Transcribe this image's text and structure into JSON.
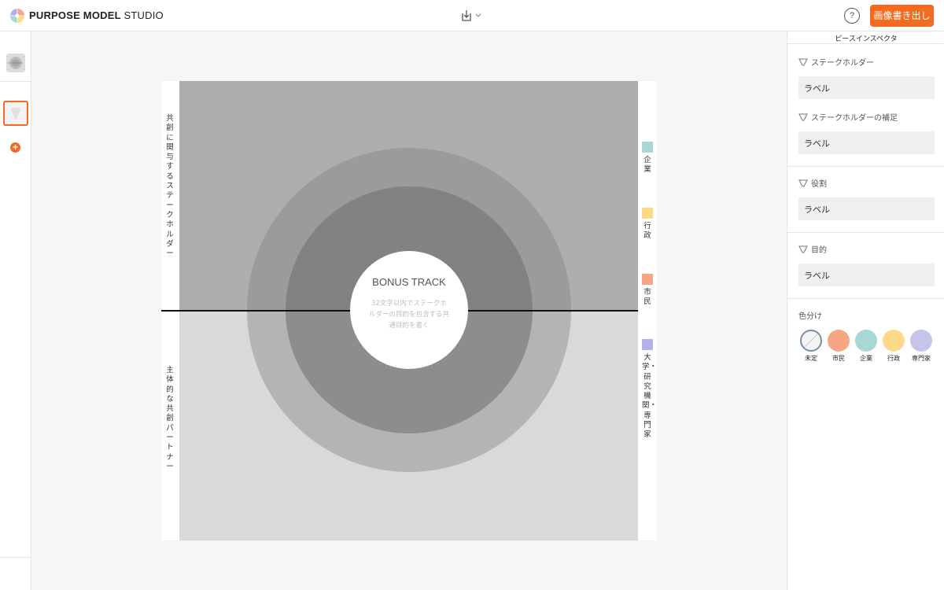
{
  "app": {
    "brand_bold": "PURPOSE MODEL",
    "brand_light": "STUDIO",
    "help_label": "?",
    "export_label": "画像書き出し"
  },
  "colors": {
    "accent": "#f26b21",
    "company": "#a7d8d3",
    "government": "#ffd98a",
    "citizen": "#f6a585",
    "expert": "#b2b1ec"
  },
  "left_rail": {
    "add_label": "+"
  },
  "canvas": {
    "top_label": "共創に関与するステークホルダー",
    "bottom_label": "主体的な共創パートナー",
    "center_title": "BONUS TRACK",
    "center_desc": "32文字以内でステークホルダーの目的を包含する共通目的を書く",
    "legend": [
      {
        "label": "企業",
        "color": "#a7d8d3"
      },
      {
        "label": "行政",
        "color": "#ffd98a"
      },
      {
        "label": "市民",
        "color": "#f6a585"
      },
      {
        "label": "大学・研究機関・専門家",
        "color": "#b2b1ec"
      }
    ]
  },
  "inspector": {
    "title": "ピースインスペクタ",
    "fields": [
      {
        "label": "ステークホルダー",
        "value": "ラベル"
      },
      {
        "label": "ステークホルダーの補足",
        "value": "ラベル"
      },
      {
        "label": "役割",
        "value": "ラベル"
      },
      {
        "label": "目的",
        "value": "ラベル"
      }
    ],
    "color_title": "色分け",
    "swatches": [
      {
        "label": "未定",
        "color": "#f4f4f4",
        "selected": true
      },
      {
        "label": "市民",
        "color": "#f6a585"
      },
      {
        "label": "企業",
        "color": "#a7d8d3"
      },
      {
        "label": "行政",
        "color": "#ffd98a"
      },
      {
        "label": "専門家",
        "color": "#b2b1ec"
      }
    ]
  }
}
